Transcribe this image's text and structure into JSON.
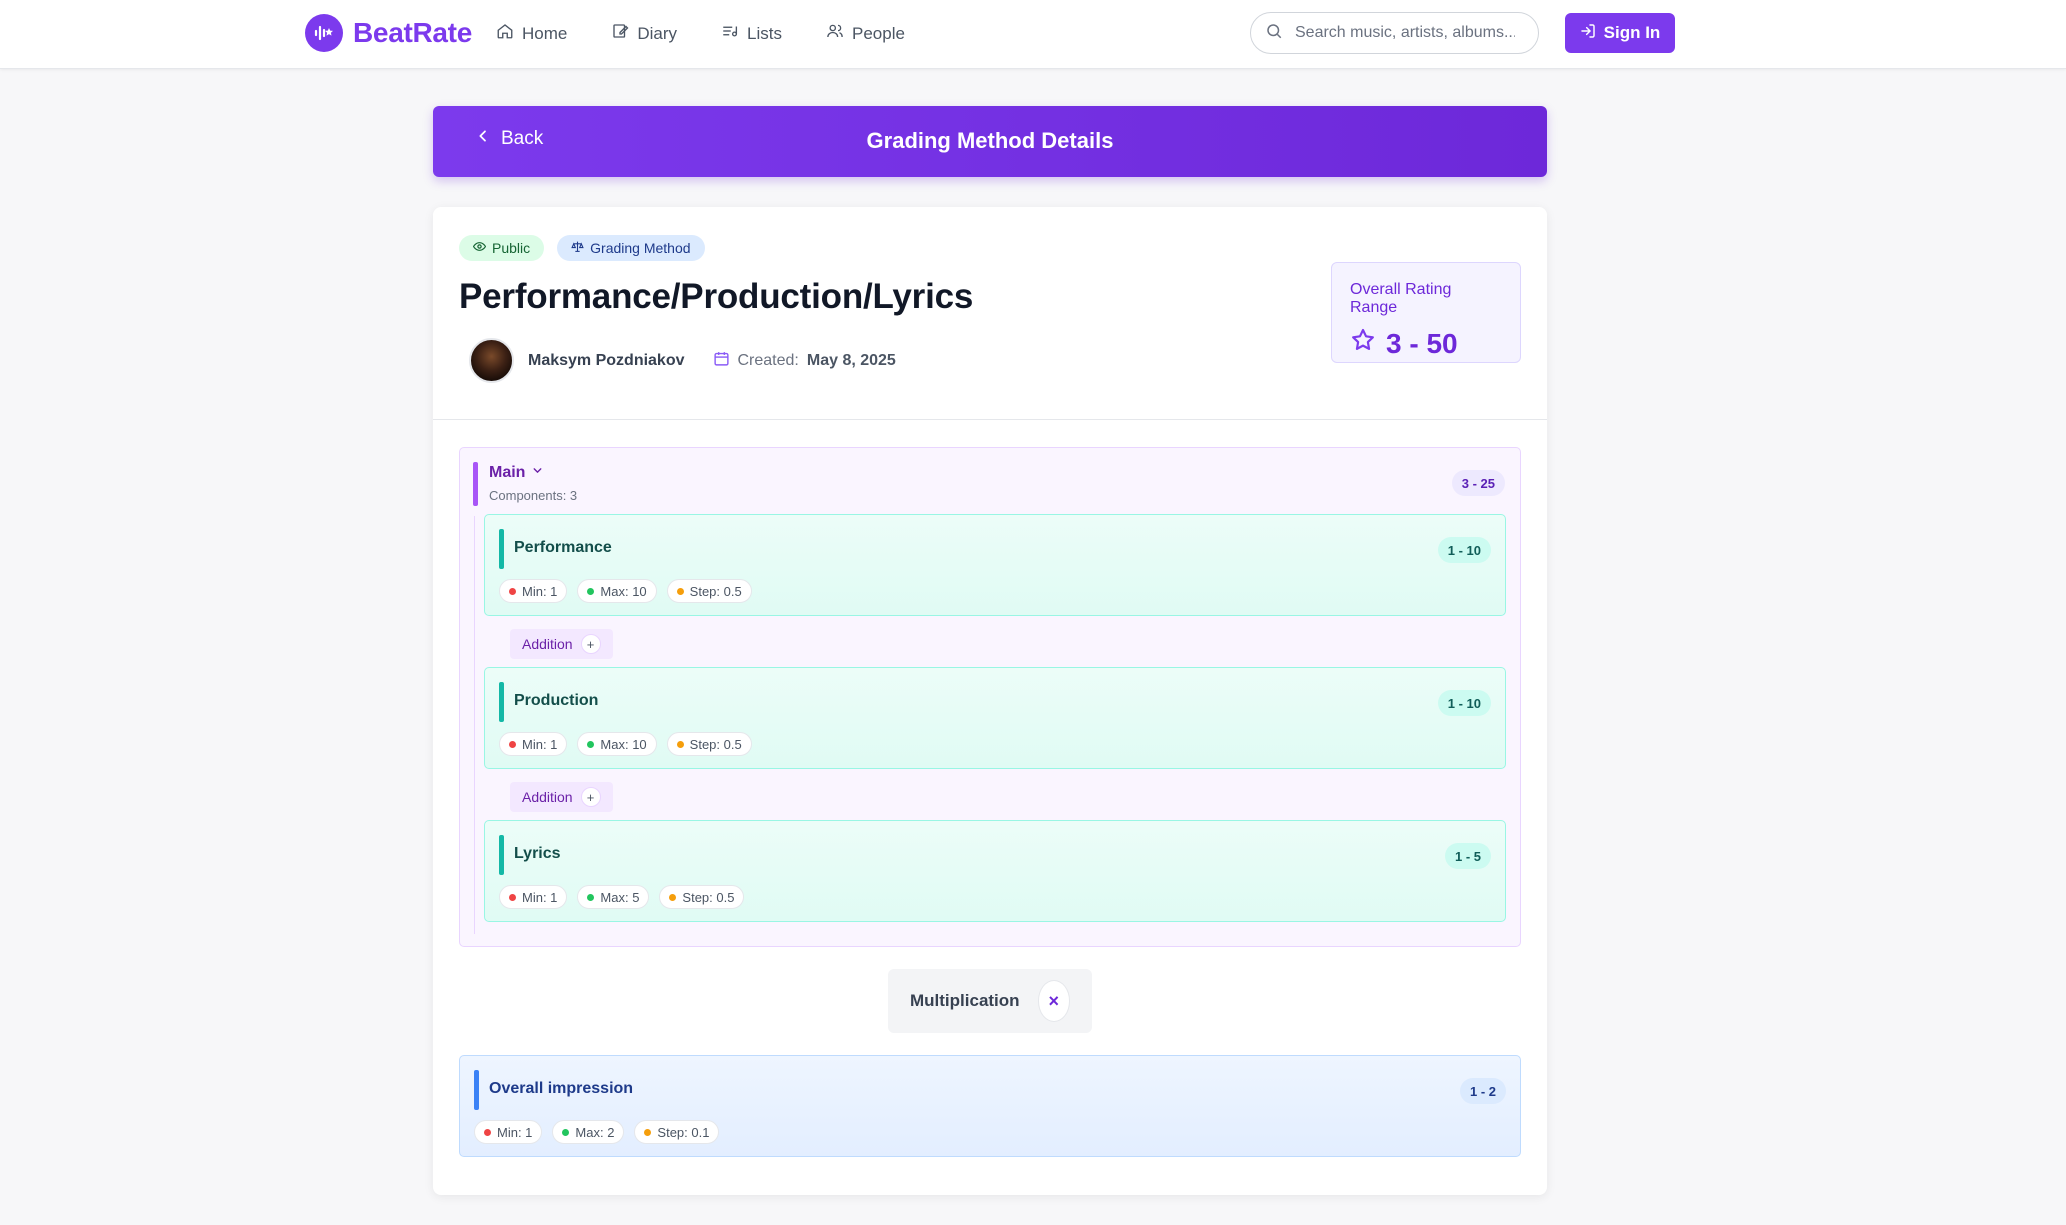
{
  "app": {
    "name": "BeatRate"
  },
  "nav": {
    "items": [
      {
        "label": "Home",
        "icon": "home-icon"
      },
      {
        "label": "Diary",
        "icon": "diary-icon"
      },
      {
        "label": "Lists",
        "icon": "lists-icon"
      },
      {
        "label": "People",
        "icon": "people-icon"
      }
    ],
    "search_placeholder": "Search music, artists, albums...",
    "signin_label": "Sign In"
  },
  "header": {
    "back_label": "Back",
    "title": "Grading Method Details"
  },
  "method": {
    "badges": {
      "visibility": "Public",
      "type": "Grading Method"
    },
    "title": "Performance/Production/Lyrics",
    "author": "Maksym Pozdniakov",
    "created_label": "Created:",
    "created_date": "May 8, 2025",
    "range_label": "Overall Rating Range",
    "range_value": "3 - 50"
  },
  "group": {
    "name": "Main",
    "components_label": "Components: 3",
    "range": "3 - 25",
    "components": [
      {
        "name": "Performance",
        "range": "1 - 10",
        "min": "Min: 1",
        "max": "Max: 10",
        "step": "Step: 0.5"
      },
      {
        "name": "Production",
        "range": "1 - 10",
        "min": "Min: 1",
        "max": "Max: 10",
        "step": "Step: 0.5"
      },
      {
        "name": "Lyrics",
        "range": "1 - 5",
        "min": "Min: 1",
        "max": "Max: 5",
        "step": "Step: 0.5"
      }
    ],
    "operations": [
      "Addition",
      "Addition"
    ],
    "operation_symbol": "+"
  },
  "combine": {
    "label": "Multiplication",
    "symbol": "×"
  },
  "overall": {
    "name": "Overall impression",
    "range": "1 - 2",
    "min": "Min: 1",
    "max": "Max: 2",
    "step": "Step: 0.1"
  },
  "colors": {
    "brand": "#7c3aed",
    "group_accent": "#a855f7",
    "component_accent": "#14b8a6",
    "overall_accent": "#3b82f6"
  }
}
